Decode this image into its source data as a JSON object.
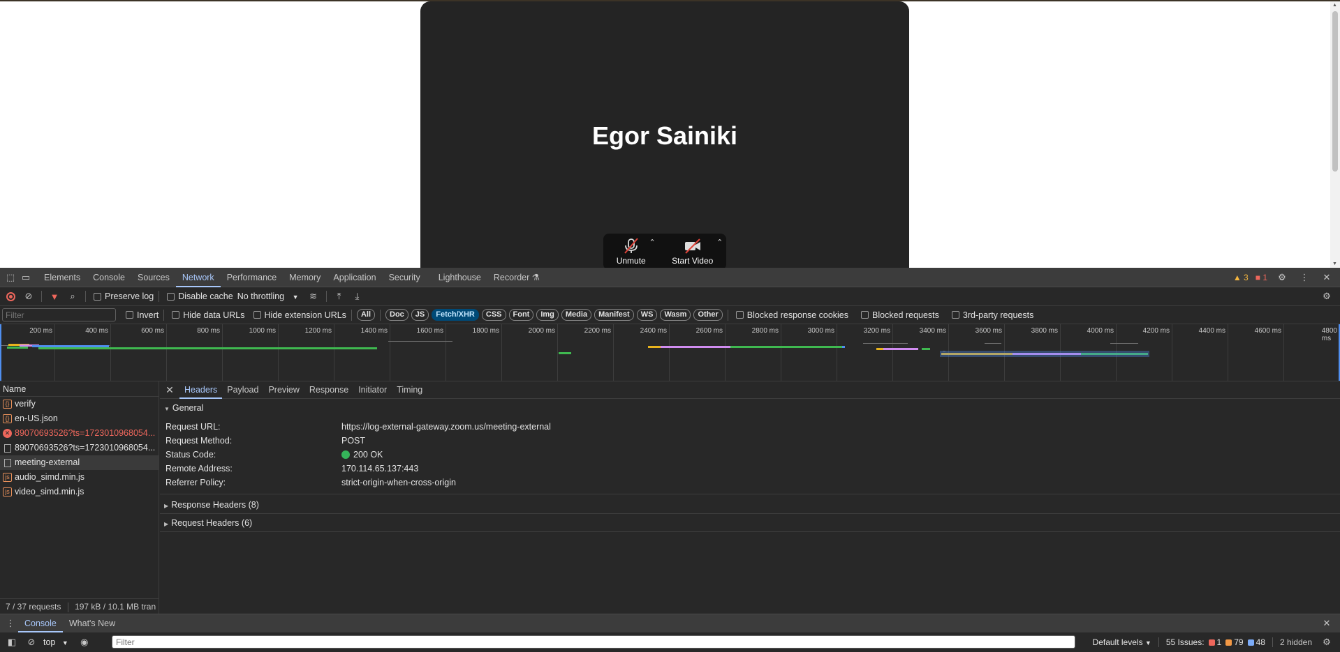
{
  "page": {
    "participant_name": "Egor Sainiki",
    "controls": [
      {
        "label": "Unmute",
        "icon": "muted-microphone-icon"
      },
      {
        "label": "Start Video",
        "icon": "video-off-icon"
      }
    ]
  },
  "devtools": {
    "tabs": [
      "Elements",
      "Console",
      "Sources",
      "Network",
      "Performance",
      "Memory",
      "Application",
      "Security",
      "Lighthouse",
      "Recorder"
    ],
    "active_tab": "Network",
    "warnings_count": "3",
    "errors_count": "1",
    "toolbar": {
      "preserve_log": "Preserve log",
      "disable_cache": "Disable cache",
      "throttling": "No throttling"
    },
    "filterbar": {
      "filter_placeholder": "Filter",
      "invert": "Invert",
      "hide_data_urls": "Hide data URLs",
      "hide_extension_urls": "Hide extension URLs",
      "types": [
        "All",
        "Doc",
        "JS",
        "Fetch/XHR",
        "CSS",
        "Font",
        "Img",
        "Media",
        "Manifest",
        "WS",
        "Wasm",
        "Other"
      ],
      "active_type": "Fetch/XHR",
      "blocked_response_cookies": "Blocked response cookies",
      "blocked_requests": "Blocked requests",
      "third_party": "3rd-party requests"
    },
    "timeline": {
      "ticks": [
        "200 ms",
        "400 ms",
        "600 ms",
        "800 ms",
        "1000 ms",
        "1200 ms",
        "1400 ms",
        "1600 ms",
        "1800 ms",
        "2000 ms",
        "2200 ms",
        "2400 ms",
        "2600 ms",
        "2800 ms",
        "3000 ms",
        "3200 ms",
        "3400 ms",
        "3600 ms",
        "3800 ms",
        "4000 ms",
        "4200 ms",
        "4400 ms",
        "4600 ms",
        "4800 ms"
      ],
      "colors": {
        "green": "#3fb950",
        "blue": "#4f8ff0",
        "purple": "#d08cf0",
        "yellow": "#e8b31d",
        "gray": "#6e6e6e"
      }
    },
    "requests": {
      "header": "Name",
      "items": [
        {
          "name": "verify",
          "type": "xhr",
          "state": "normal"
        },
        {
          "name": "en-US.json",
          "type": "xhr",
          "state": "normal"
        },
        {
          "name": "89070693526?ts=1723010968054...",
          "type": "err",
          "state": "error"
        },
        {
          "name": "89070693526?ts=1723010968054...",
          "type": "doc",
          "state": "normal"
        },
        {
          "name": "meeting-external",
          "type": "doc",
          "state": "selected"
        },
        {
          "name": "audio_simd.min.js",
          "type": "js",
          "state": "normal"
        },
        {
          "name": "video_simd.min.js",
          "type": "js",
          "state": "normal"
        }
      ],
      "footer_requests": "7 / 37 requests",
      "footer_transfer": "197 kB / 10.1 MB tran"
    },
    "detail": {
      "tabs": [
        "Headers",
        "Payload",
        "Preview",
        "Response",
        "Initiator",
        "Timing"
      ],
      "active_tab": "Headers",
      "general_title": "General",
      "general": [
        {
          "key": "Request URL:",
          "value": "https://log-external-gateway.zoom.us/meeting-external"
        },
        {
          "key": "Request Method:",
          "value": "POST"
        },
        {
          "key": "Status Code:",
          "value": "200 OK",
          "status_dot": true
        },
        {
          "key": "Remote Address:",
          "value": "170.114.65.137:443"
        },
        {
          "key": "Referrer Policy:",
          "value": "strict-origin-when-cross-origin"
        }
      ],
      "response_headers": "Response Headers (8)",
      "request_headers": "Request Headers (6)"
    },
    "drawer": {
      "tabs": [
        "Console",
        "What's New"
      ],
      "active_tab": "Console",
      "context": "top",
      "filter_placeholder": "Filter",
      "levels": "Default levels",
      "issues_label": "55 Issues:",
      "issues_errors": "1",
      "issues_warnings": "79",
      "issues_info": "48",
      "hidden": "2 hidden"
    }
  }
}
